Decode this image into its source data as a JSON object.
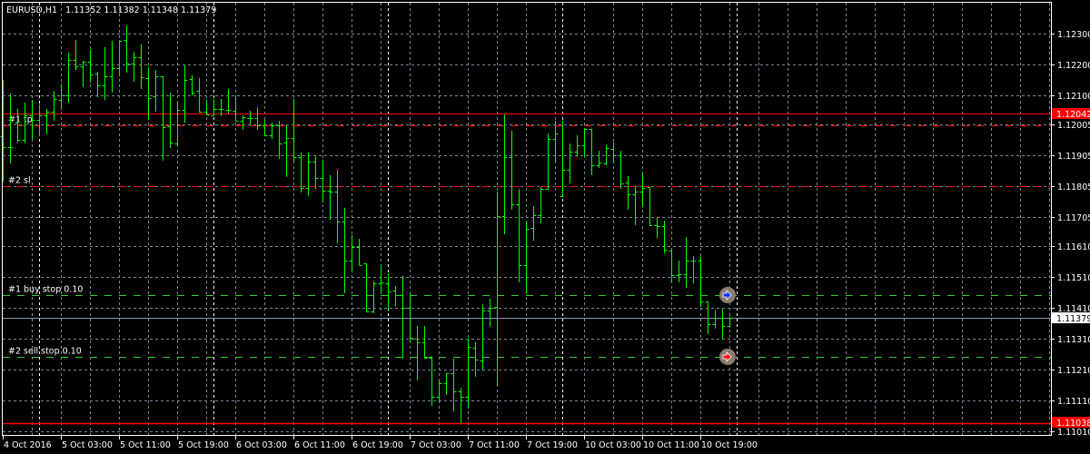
{
  "header": {
    "symbol": "EURUSD,H1",
    "ohlc": "1.11352 1.11382 1.11348 1.11379"
  },
  "price_axis": {
    "labels": [
      "1.12300",
      "1.12200",
      "1.12100",
      "1.12005",
      "1.11905",
      "1.11805",
      "1.11705",
      "1.11610",
      "1.11510",
      "1.11410",
      "1.11310",
      "1.11210",
      "1.11110",
      "1.11010"
    ],
    "markers": [
      {
        "value": "1.12042",
        "kind": "red-line",
        "bg": "#ff0000",
        "fg": "#ffffff"
      },
      {
        "value": "1.11379",
        "kind": "bid-line",
        "bg": "#ffffff",
        "fg": "#000000"
      },
      {
        "value": "1.11038",
        "kind": "red-line",
        "bg": "#ff0000",
        "fg": "#ffffff"
      }
    ]
  },
  "time_axis": {
    "labels": [
      "4 Oct 2016",
      "5 Oct 03:00",
      "5 Oct 11:00",
      "5 Oct 19:00",
      "6 Oct 03:00",
      "6 Oct 11:00",
      "6 Oct 19:00",
      "7 Oct 03:00",
      "7 Oct 11:00",
      "7 Oct 19:00",
      "10 Oct 03:00",
      "10 Oct 11:00",
      "10 Oct 19:00"
    ]
  },
  "order_lines": [
    {
      "label": "#1 tp",
      "color": "#ff0000"
    },
    {
      "label": "#2 sl",
      "color": "#ff0000"
    },
    {
      "label": "#1 buy stop 0.10",
      "color": "#32cd32",
      "icon": "buy-arrow-icon"
    },
    {
      "label": "#2 sell stop 0.10",
      "color": "#32cd32",
      "icon": "sell-arrow-icon"
    }
  ],
  "colors": {
    "bars": "#00ff00",
    "grid": "#778899",
    "separator": "#ffffff"
  },
  "chart_data": {
    "type": "ohlc",
    "symbol": "EURUSD",
    "timeframe": "H1",
    "ylim": [
      1.1101,
      1.1232
    ],
    "bars": [
      [
        1.11967,
        1.1215,
        1.1182,
        1.11932
      ],
      [
        1.11932,
        1.12106,
        1.11879,
        1.11932
      ],
      [
        1.12011,
        1.12056,
        1.11947,
        1.11955
      ],
      [
        1.11955,
        1.12076,
        1.11944,
        1.12035
      ],
      [
        1.12035,
        1.12085,
        1.11958,
        1.1202
      ],
      [
        1.1202,
        1.1207,
        1.11967,
        1.12035
      ],
      [
        1.12035,
        1.12056,
        1.11973,
        1.12047
      ],
      [
        1.12047,
        1.12114,
        1.12017,
        1.12088
      ],
      [
        1.12085,
        1.12138,
        1.12053,
        1.121
      ],
      [
        1.121,
        1.12238,
        1.12076,
        1.12215
      ],
      [
        1.12215,
        1.12279,
        1.12182,
        1.12194
      ],
      [
        1.12194,
        1.12212,
        1.12126,
        1.12209
      ],
      [
        1.12209,
        1.12247,
        1.12141,
        1.12168
      ],
      [
        1.1217,
        1.12176,
        1.12094,
        1.12132
      ],
      [
        1.12132,
        1.12256,
        1.12085,
        1.12162
      ],
      [
        1.12162,
        1.12276,
        1.12109,
        1.12188
      ],
      [
        1.12188,
        1.12279,
        1.12165,
        1.12276
      ],
      [
        1.12279,
        1.12326,
        1.12173,
        1.12203
      ],
      [
        1.12203,
        1.12241,
        1.12144,
        1.12223
      ],
      [
        1.12223,
        1.12265,
        1.1212,
        1.12159
      ],
      [
        1.12156,
        1.12191,
        1.1202,
        1.12091
      ],
      [
        1.12097,
        1.12182,
        1.12047,
        1.12162
      ],
      [
        1.12162,
        1.12162,
        1.11888,
        1.11997
      ],
      [
        1.12,
        1.12109,
        1.11929,
        1.11947
      ],
      [
        1.11944,
        1.12076,
        1.11938,
        1.12053
      ],
      [
        1.12053,
        1.12197,
        1.12011,
        1.1215
      ],
      [
        1.12153,
        1.12165,
        1.121,
        1.12109
      ],
      [
        1.12114,
        1.12156,
        1.12044,
        1.12047
      ],
      [
        1.12047,
        1.12085,
        1.12035,
        1.12038
      ],
      [
        1.12035,
        1.12088,
        1.12035,
        1.12056
      ],
      [
        1.12056,
        1.12088,
        1.12032,
        1.12056
      ],
      [
        1.12053,
        1.1212,
        1.12041,
        1.12053
      ],
      [
        1.1205,
        1.121,
        1.12017,
        1.12017
      ],
      [
        1.12017,
        1.12035,
        1.11988,
        1.12029
      ],
      [
        1.12026,
        1.1205,
        1.12003,
        1.12026
      ],
      [
        1.12026,
        1.12061,
        1.11988,
        1.12003
      ],
      [
        1.12003,
        1.1202,
        1.11967,
        1.1197
      ],
      [
        1.1197,
        1.12011,
        1.11958,
        1.12003
      ],
      [
        1.12003,
        1.12017,
        1.11894,
        1.11944
      ],
      [
        1.11947,
        1.12003,
        1.11835,
        1.11961
      ],
      [
        1.11961,
        1.12088,
        1.11885,
        1.11899
      ],
      [
        1.11899,
        1.11914,
        1.11785,
        1.11799
      ],
      [
        1.11799,
        1.11914,
        1.11773,
        1.11885
      ],
      [
        1.11885,
        1.11902,
        1.11796,
        1.11832
      ],
      [
        1.11832,
        1.11891,
        1.11752,
        1.1179
      ],
      [
        1.1179,
        1.11841,
        1.11696,
        1.11788
      ],
      [
        1.11788,
        1.11858,
        1.1162,
        1.1169
      ],
      [
        1.1169,
        1.11735,
        1.11458,
        1.11564
      ],
      [
        1.11564,
        1.11646,
        1.11525,
        1.11608
      ],
      [
        1.11608,
        1.11634,
        1.11549,
        1.11549
      ],
      [
        1.11555,
        1.11555,
        1.11399,
        1.11399
      ],
      [
        1.11399,
        1.11496,
        1.11393,
        1.1149
      ],
      [
        1.1149,
        1.11549,
        1.11458,
        1.11493
      ],
      [
        1.1149,
        1.1152,
        1.11408,
        1.11464
      ],
      [
        1.11466,
        1.11481,
        1.11416,
        1.11452
      ],
      [
        1.11452,
        1.11514,
        1.11246,
        1.11411
      ],
      [
        1.11411,
        1.11458,
        1.11299,
        1.11313
      ],
      [
        1.1131,
        1.11352,
        1.11175,
        1.11299
      ],
      [
        1.11299,
        1.11352,
        1.11246,
        1.11249
      ],
      [
        1.11249,
        1.11254,
        1.11092,
        1.11122
      ],
      [
        1.11122,
        1.11172,
        1.11107,
        1.11166
      ],
      [
        1.11166,
        1.11199,
        1.11128,
        1.11199
      ],
      [
        1.11199,
        1.11246,
        1.11075,
        1.1114
      ],
      [
        1.1114,
        1.11151,
        1.11037,
        1.11122
      ],
      [
        1.11122,
        1.1131,
        1.1109,
        1.11284
      ],
      [
        1.11281,
        1.11299,
        1.11187,
        1.11243
      ],
      [
        1.1124,
        1.11422,
        1.11207,
        1.11402
      ],
      [
        1.11402,
        1.1144,
        1.11349,
        1.11411
      ],
      [
        1.11413,
        1.11788,
        1.1116,
        1.11708
      ],
      [
        1.11708,
        1.12038,
        1.11649,
        1.11899
      ],
      [
        1.11899,
        1.11985,
        1.11729,
        1.11746
      ],
      [
        1.11746,
        1.11796,
        1.11493,
        1.11549
      ],
      [
        1.11549,
        1.11693,
        1.11458,
        1.11667
      ],
      [
        1.1167,
        1.1174,
        1.11628,
        1.11711
      ],
      [
        1.11711,
        1.11802,
        1.11684,
        1.11796
      ],
      [
        1.11796,
        1.11976,
        1.11793,
        1.11958
      ],
      [
        1.11958,
        1.12017,
        1.11885,
        1.11976
      ],
      [
        1.11773,
        1.12017,
        1.1177,
        1.11858
      ],
      [
        1.11858,
        1.11944,
        1.11814,
        1.11917
      ],
      [
        1.11917,
        1.1197,
        1.11899,
        1.11938
      ],
      [
        1.11938,
        1.11994,
        1.11902,
        1.11991
      ],
      [
        1.11991,
        1.11991,
        1.11841,
        1.11873
      ],
      [
        1.11873,
        1.1192,
        1.11864,
        1.11882
      ],
      [
        1.11879,
        1.11938,
        1.11873,
        1.11929
      ],
      [
        1.11926,
        1.11947,
        1.11882,
        1.11905
      ],
      [
        1.11905,
        1.1192,
        1.11796,
        1.11814
      ],
      [
        1.11817,
        1.11838,
        1.11729,
        1.11779
      ],
      [
        1.11779,
        1.11802,
        1.11679,
        1.11788
      ],
      [
        1.11788,
        1.11852,
        1.1174,
        1.11799
      ],
      [
        1.11802,
        1.11802,
        1.11676,
        1.11679
      ],
      [
        1.11679,
        1.11702,
        1.11637,
        1.11676
      ],
      [
        1.11676,
        1.11693,
        1.11587,
        1.11599
      ],
      [
        1.11596,
        1.11605,
        1.11493,
        1.11517
      ],
      [
        1.11517,
        1.11564,
        1.11493,
        1.1152
      ],
      [
        1.1152,
        1.1164,
        1.11475,
        1.11564
      ],
      [
        1.11564,
        1.11578,
        1.1149,
        1.11564
      ],
      [
        1.11564,
        1.11575,
        1.11413,
        1.11431
      ],
      [
        1.11431,
        1.11431,
        1.11325,
        1.11357
      ],
      [
        1.11357,
        1.11402,
        1.11343,
        1.11378
      ],
      [
        1.11378,
        1.11408,
        1.11307,
        1.11352
      ],
      [
        1.11352,
        1.11382,
        1.11348,
        1.11379
      ]
    ]
  }
}
